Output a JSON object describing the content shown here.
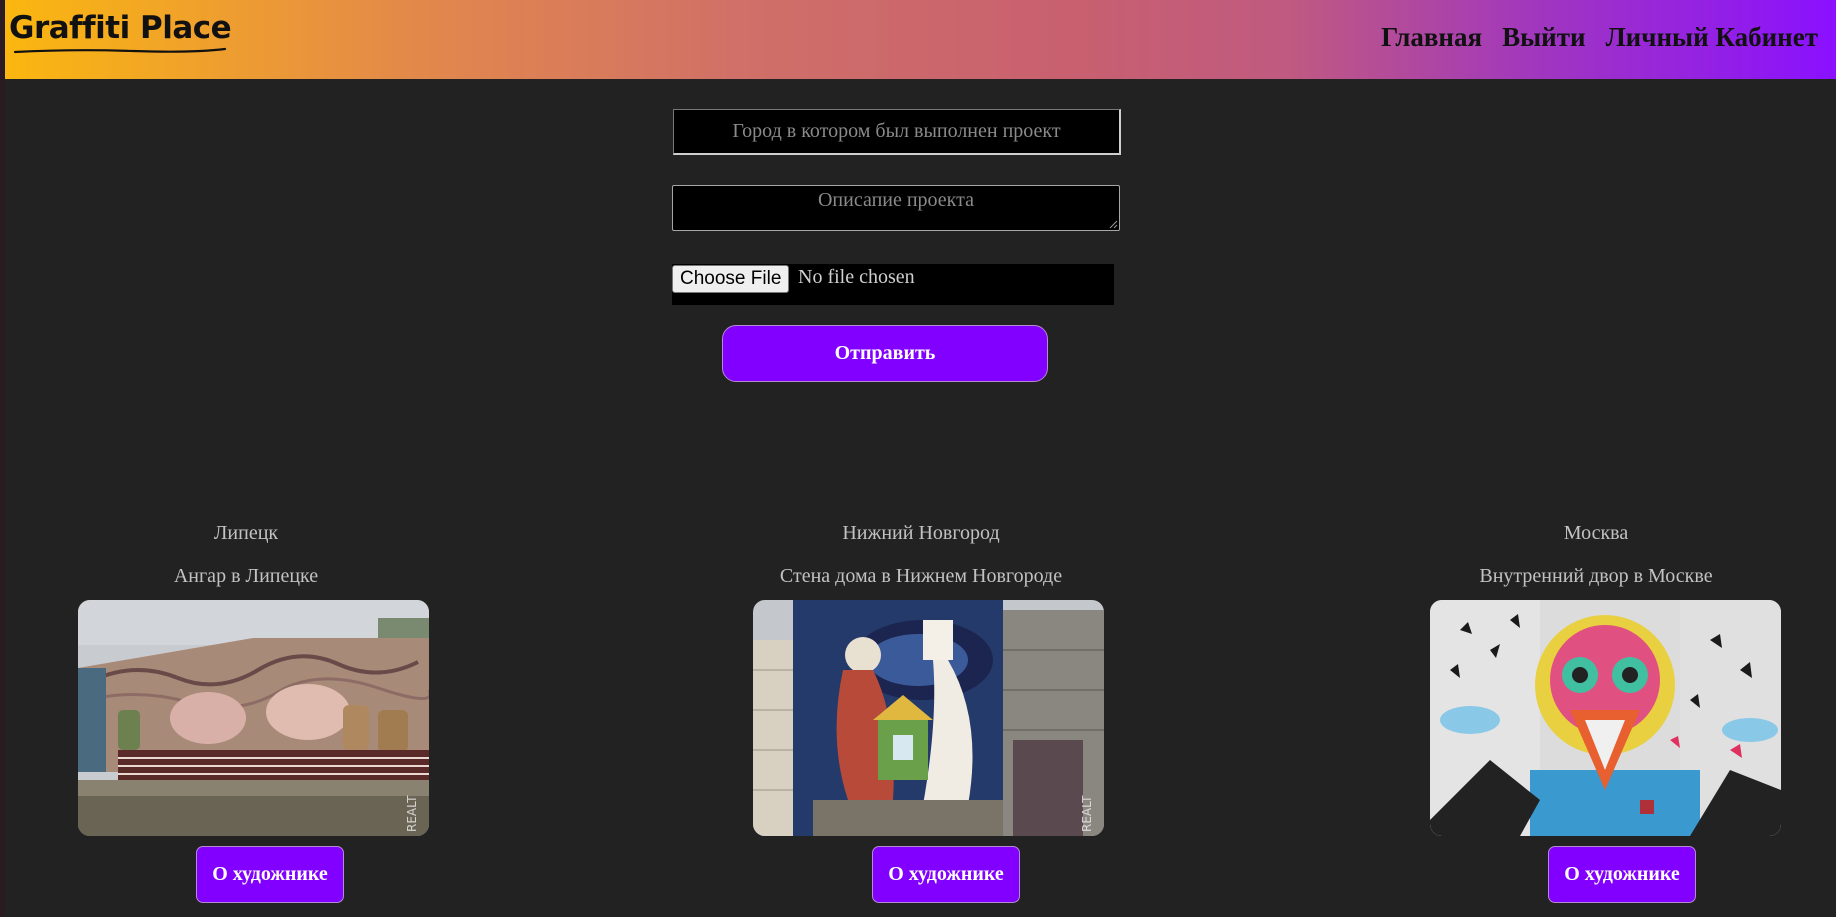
{
  "header": {
    "logo": "Graffiti Place",
    "nav": [
      {
        "label": "Главная"
      },
      {
        "label": "Выйти"
      },
      {
        "label": "Личный Кабинет"
      }
    ]
  },
  "form": {
    "city_placeholder": "Город в котором был выполнен проект",
    "description_placeholder": "Описапие проекта",
    "file_button_label": "Choose File",
    "file_status": "No file chosen",
    "submit_label": "Отправить"
  },
  "projects": [
    {
      "city": "Липецк",
      "title": "Ангар в Липецке",
      "button_label": "О художнике",
      "watermark": "REALT"
    },
    {
      "city": "Нижний Новгород",
      "title": "Стена дома в Нижнем Новгороде",
      "button_label": "О художнике",
      "watermark": "REALT"
    },
    {
      "city": "Москва",
      "title": "Внутренний двор в Москве",
      "button_label": "О художнике"
    }
  ],
  "colors": {
    "accent": "#8200ff",
    "page_background": "#222222",
    "header_gradient_start": "#fbb70f",
    "header_gradient_end": "#8a10ff"
  }
}
